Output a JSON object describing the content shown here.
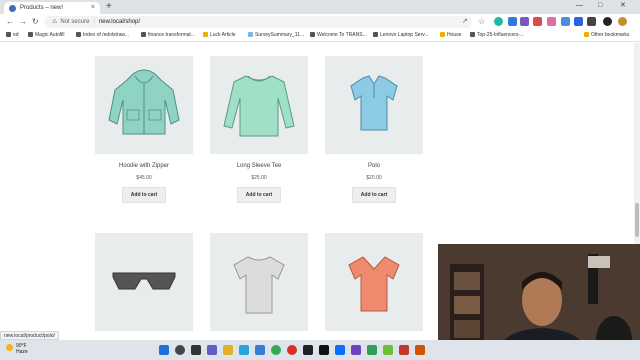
{
  "browser": {
    "tab_title": "Products – new!",
    "tab_close": "×",
    "new_tab": "+",
    "url_security": "Not secure",
    "url": "new.local/shop/",
    "status_url": "new.local/product/polo/"
  },
  "bookmarks": [
    "ed",
    "Magic Autofill",
    "Index of /edolstraw...",
    "finance transformat...",
    "Luck Article",
    "SurveySummary_11...",
    "Welcome To TRANS...",
    "Lenovo Laptop Serv...",
    "House",
    "Top-25-Influencers-..."
  ],
  "other_bookmarks": "Other bookmarks",
  "products": [
    {
      "name": "Hoodie with Zipper",
      "price": "$45.00",
      "button": "Add to cart",
      "icon": "hoodie-icon",
      "color": "#8fd3c4"
    },
    {
      "name": "Long Sleeve Tee",
      "price": "$25.00",
      "button": "Add to cart",
      "icon": "long-sleeve-tee-icon",
      "color": "#9fe0c6"
    },
    {
      "name": "Polo",
      "price": "$20.00",
      "button": "Add to cart",
      "icon": "polo-shirt-icon",
      "color": "#8ccbe6"
    }
  ],
  "products_row2": [
    {
      "icon": "sunglasses-icon",
      "color": "#555555"
    },
    {
      "icon": "t-shirt-icon",
      "color": "#dcdcdc"
    },
    {
      "icon": "v-neck-tee-icon",
      "color": "#f08a6e"
    }
  ],
  "taskbar": {
    "temperature": "90°F",
    "condition": "Haze"
  }
}
